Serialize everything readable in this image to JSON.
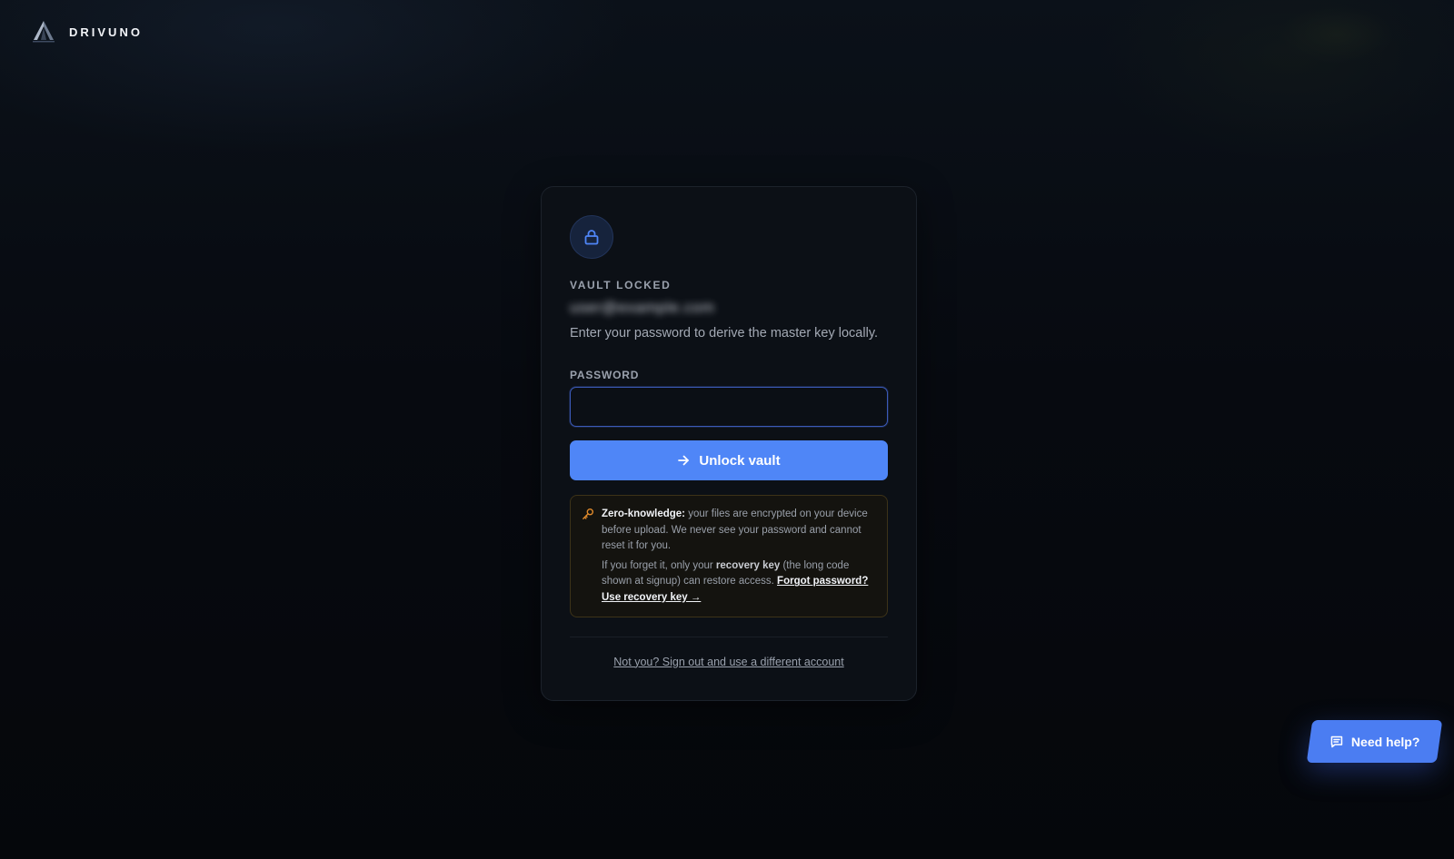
{
  "brand": {
    "name": "DRIVUNO",
    "logo_icon": "drivuno-logo-icon"
  },
  "card": {
    "icon": "lock-icon",
    "eyebrow": "VAULT LOCKED",
    "email": "user@example.com",
    "subtitle": "Enter your password to derive the master key locally.",
    "password_label": "PASSWORD",
    "password_value": "",
    "unlock_label": "Unlock vault",
    "notice": {
      "icon": "key-icon",
      "bold": "Zero-knowledge:",
      "text1": " your files are encrypted on your device before upload. We never see your password and cannot reset it for you.",
      "text2_prefix": "If you forget it, only your ",
      "text2_strong": "recovery key",
      "text2_suffix": " (the long code shown at signup) can restore access. ",
      "link": "Forgot password? Use recovery key →"
    },
    "switch_account": "Not you? Sign out and use a different account"
  },
  "help": {
    "label": "Need help?",
    "icon": "chat-icon"
  },
  "colors": {
    "accent": "#4f86f7",
    "notice_border": "#3d3318",
    "key_icon": "#e08a2c"
  }
}
